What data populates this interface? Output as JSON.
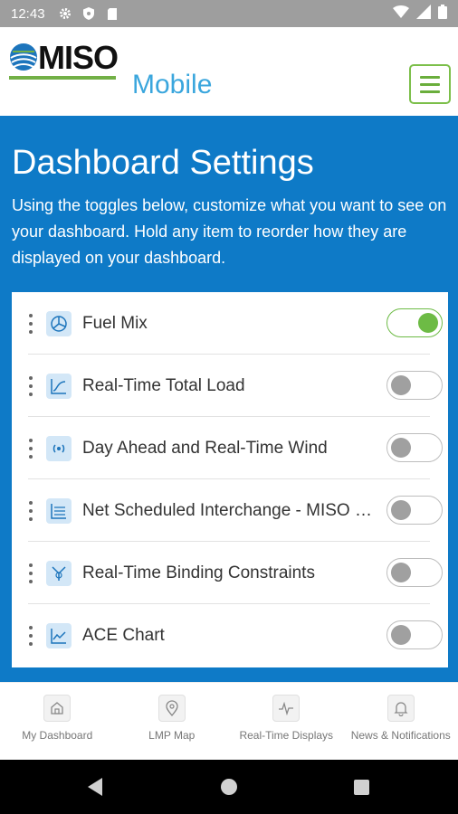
{
  "status_bar": {
    "time": "12:43",
    "left_icons": [
      "gear-icon",
      "shield-icon",
      "sd-card-icon"
    ],
    "right_icons": [
      "wifi-icon",
      "signal-icon",
      "battery-icon"
    ]
  },
  "header": {
    "logo_text": "MISO",
    "app_label": "Mobile",
    "menu_icon": "hamburger-menu-icon",
    "colors": {
      "brand_blue": "#3aa6dd",
      "brand_green": "#72b046"
    }
  },
  "page": {
    "title": "Dashboard Settings",
    "description": "Using the toggles below, customize what you want to see on your dashboard. Hold any item to reorder how they are displayed on your dashboard.",
    "background_color": "#0e7ac7"
  },
  "settings": {
    "items": [
      {
        "label": "Fuel Mix",
        "icon": "fuel-mix-icon",
        "enabled": true
      },
      {
        "label": "Real-Time Total Load",
        "icon": "load-chart-icon",
        "enabled": false
      },
      {
        "label": "Day Ahead and Real-Time Wind",
        "icon": "wind-icon",
        "enabled": false
      },
      {
        "label": "Net Scheduled Interchange - MISO F...",
        "icon": "interchange-icon",
        "enabled": false
      },
      {
        "label": "Real-Time Binding Constraints",
        "icon": "constraints-icon",
        "enabled": false
      },
      {
        "label": "ACE Chart",
        "icon": "ace-chart-icon",
        "enabled": false
      }
    ],
    "toggle_on_color": "#6dbb45"
  },
  "bottom_nav": {
    "items": [
      {
        "label": "My Dashboard",
        "icon": "home-icon"
      },
      {
        "label": "LMP Map",
        "icon": "map-pin-icon"
      },
      {
        "label": "Real-Time Displays",
        "icon": "pulse-icon"
      },
      {
        "label": "News & Notifications",
        "icon": "bell-icon"
      }
    ]
  }
}
